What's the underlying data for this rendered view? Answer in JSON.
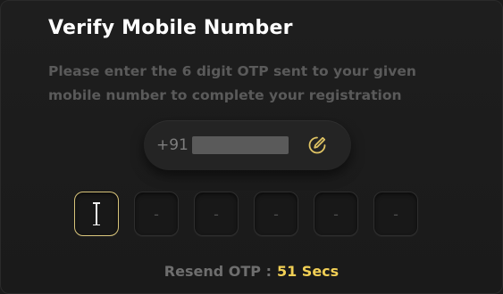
{
  "header": {
    "title": "Verify Mobile Number"
  },
  "instructions": {
    "text": "Please enter the 6 digit OTP sent to your given mobile number to complete your registration"
  },
  "phone": {
    "prefix": "+91"
  },
  "otp": {
    "placeholders": [
      "-",
      "-",
      "-",
      "-",
      "-"
    ]
  },
  "resend": {
    "label": "Resend OTP :",
    "timer": "51 Secs"
  },
  "colors": {
    "accent": "#f1cf55",
    "active_border": "#d8c47a",
    "background": "#1b1b1b"
  },
  "icons": {
    "edit": "pencil-edit-icon"
  }
}
